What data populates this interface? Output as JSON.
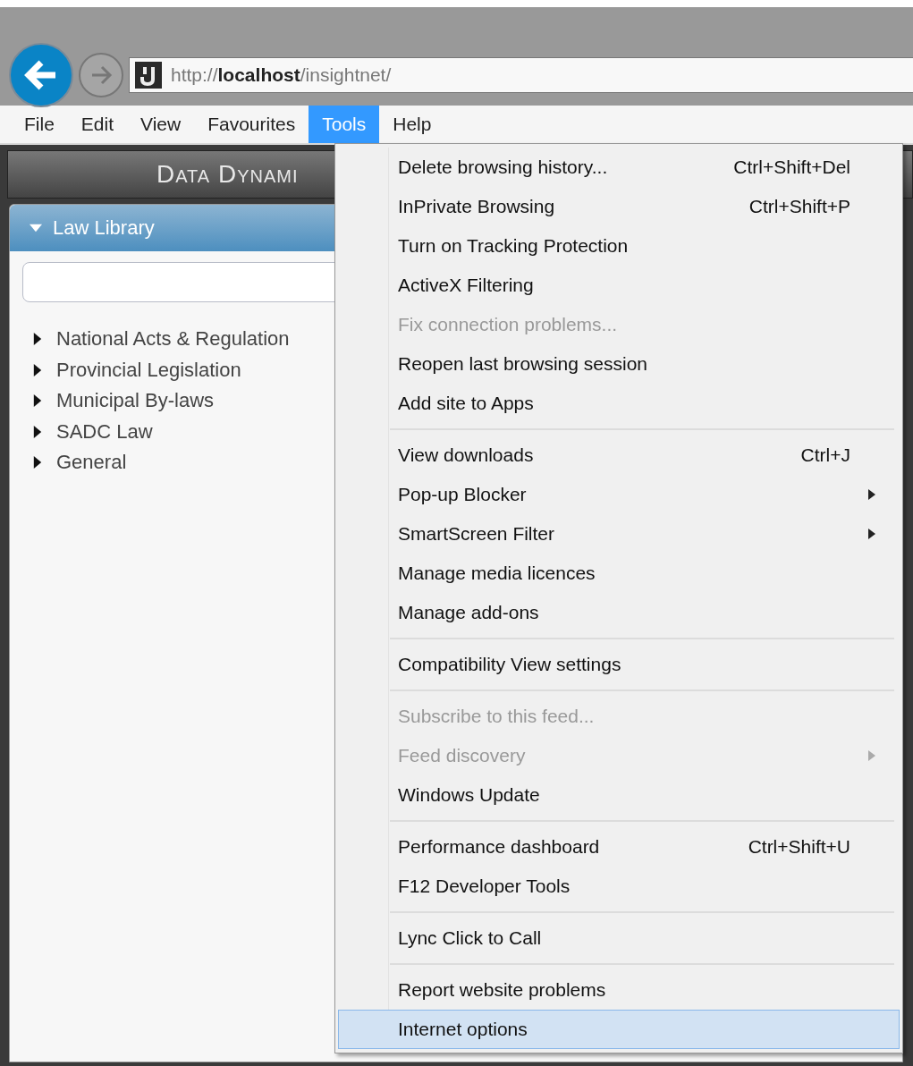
{
  "toolbar": {
    "address": "http://**localhost**/insightnet/"
  },
  "menu_bar": [
    {
      "label": "File",
      "selected": false
    },
    {
      "label": "Edit",
      "selected": false
    },
    {
      "label": "View",
      "selected": false
    },
    {
      "label": "Favourites",
      "selected": false
    },
    {
      "label": "Tools",
      "selected": true
    },
    {
      "label": "Help",
      "selected": false
    }
  ],
  "page": {
    "banner": "Data Dynami",
    "panel": {
      "title": "Law Library",
      "expanded": true,
      "tree": [
        {
          "label": "National Acts & Regulation",
          "expanded": false
        },
        {
          "label": "Provincial Legislation",
          "expanded": false
        },
        {
          "label": "Municipal By-laws",
          "expanded": false
        },
        {
          "label": "SADC Law",
          "expanded": false
        },
        {
          "label": "General",
          "expanded": false
        }
      ]
    }
  },
  "tools_menu": [
    {
      "kind": "item",
      "label": "Delete browsing history...",
      "shortcut": "Ctrl+Shift+Del",
      "submenu": false,
      "disabled": false,
      "selected": false
    },
    {
      "kind": "item",
      "label": "InPrivate Browsing",
      "shortcut": "Ctrl+Shift+P",
      "submenu": false,
      "disabled": false,
      "selected": false
    },
    {
      "kind": "item",
      "label": "Turn on Tracking Protection",
      "submenu": false,
      "disabled": false,
      "selected": false
    },
    {
      "kind": "item",
      "label": "ActiveX Filtering",
      "submenu": false,
      "disabled": false,
      "selected": false
    },
    {
      "kind": "item",
      "label": "Fix connection problems...",
      "submenu": false,
      "disabled": true,
      "selected": false
    },
    {
      "kind": "item",
      "label": "Reopen last browsing session",
      "submenu": false,
      "disabled": false,
      "selected": false
    },
    {
      "kind": "item",
      "label": "Add site to Apps",
      "submenu": false,
      "disabled": false,
      "selected": false
    },
    {
      "kind": "separator"
    },
    {
      "kind": "item",
      "label": "View downloads",
      "shortcut": "Ctrl+J",
      "submenu": false,
      "disabled": false,
      "selected": false
    },
    {
      "kind": "item",
      "label": "Pop-up Blocker",
      "submenu": true,
      "disabled": false,
      "selected": false
    },
    {
      "kind": "item",
      "label": "SmartScreen Filter",
      "submenu": true,
      "disabled": false,
      "selected": false
    },
    {
      "kind": "item",
      "label": "Manage media licences",
      "submenu": false,
      "disabled": false,
      "selected": false
    },
    {
      "kind": "item",
      "label": "Manage add-ons",
      "submenu": false,
      "disabled": false,
      "selected": false
    },
    {
      "kind": "separator"
    },
    {
      "kind": "item",
      "label": "Compatibility View settings",
      "submenu": false,
      "disabled": false,
      "selected": false
    },
    {
      "kind": "separator"
    },
    {
      "kind": "item",
      "label": "Subscribe to this feed...",
      "submenu": false,
      "disabled": true,
      "selected": false
    },
    {
      "kind": "item",
      "label": "Feed discovery",
      "submenu": true,
      "disabled": true,
      "selected": false
    },
    {
      "kind": "item",
      "label": "Windows Update",
      "submenu": false,
      "disabled": false,
      "selected": false
    },
    {
      "kind": "separator"
    },
    {
      "kind": "item",
      "label": "Performance dashboard",
      "shortcut": "Ctrl+Shift+U",
      "submenu": false,
      "disabled": false,
      "selected": false
    },
    {
      "kind": "item",
      "label": "F12 Developer Tools",
      "submenu": false,
      "disabled": false,
      "selected": false
    },
    {
      "kind": "separator"
    },
    {
      "kind": "item",
      "label": "Lync Click to Call",
      "submenu": false,
      "disabled": false,
      "selected": false
    },
    {
      "kind": "separator"
    },
    {
      "kind": "item",
      "label": "Report website problems",
      "submenu": false,
      "disabled": false,
      "selected": false
    },
    {
      "kind": "item",
      "label": "Internet options",
      "submenu": false,
      "disabled": false,
      "selected": true
    }
  ]
}
